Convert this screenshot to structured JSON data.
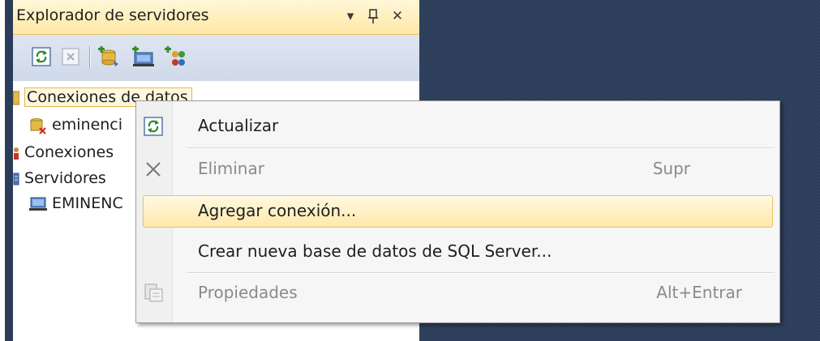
{
  "panel": {
    "title": "Explorador de servidores",
    "buttons": {
      "pin_glyph": "▾",
      "autohide_glyph": "ꟼ",
      "close_glyph": "✕"
    }
  },
  "toolbar": {
    "buttons": [
      "refresh-icon",
      "delete-icon",
      "add-connection-icon",
      "connect-server-icon",
      "sharepoint-connection-icon"
    ]
  },
  "tree": {
    "items": [
      {
        "label": "Conexiones de datos",
        "icon": "database-icon",
        "selected": true
      },
      {
        "label": "eminenci",
        "icon": "broken-connection-icon"
      },
      {
        "label": "Conexiones",
        "icon": "sharepoint-icon"
      },
      {
        "label": "Servidores",
        "icon": "servers-icon"
      },
      {
        "label": "EMINENC",
        "icon": "computer-icon"
      }
    ]
  },
  "context_menu": {
    "items": [
      {
        "label": "Actualizar",
        "shortcut": "",
        "enabled": true,
        "icon": "refresh-icon"
      },
      {
        "label": "Eliminar",
        "shortcut": "Supr",
        "enabled": false,
        "icon": "delete-x-icon"
      },
      {
        "label": "Agregar conexión...",
        "shortcut": "",
        "enabled": true,
        "hover": true,
        "icon": ""
      },
      {
        "label": "Crear nueva base de datos de SQL Server...",
        "shortcut": "",
        "enabled": true,
        "icon": ""
      },
      {
        "label": "Propiedades",
        "shortcut": "Alt+Entrar",
        "enabled": false,
        "icon": "properties-icon"
      }
    ]
  },
  "colors": {
    "title_bar": "#ffe8a6",
    "toolbar": "#d6dfee",
    "document_area": "#2b3c59",
    "menu_highlight": "#ffe9a9"
  }
}
